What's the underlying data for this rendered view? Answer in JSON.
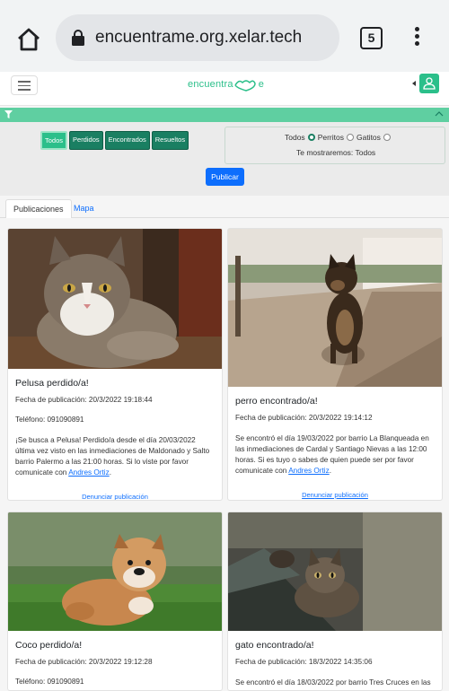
{
  "browser": {
    "url": "encuentrame.org.xelar.tech",
    "tab_count": "5"
  },
  "header": {
    "logo_text_1": "encuentra",
    "logo_text_2": "e",
    "brand_color": "#2bbf8a"
  },
  "filters": {
    "status_buttons": [
      "Todos",
      "Perdidos",
      "Encontrados",
      "Resueltos"
    ],
    "active_status": "Todos",
    "type_label": "Todos",
    "type_options": [
      "Perritos",
      "Gatitos"
    ],
    "selected_type": "Perritos",
    "showing_text": "Te mostraremos: Todos",
    "publish_label": "Publicar"
  },
  "tabs": {
    "publicaciones": "Publicaciones",
    "mapa": "Mapa"
  },
  "posts": [
    {
      "title": "Pelusa perdido/a!",
      "date": "Fecha de publicación: 20/3/2022 19:18:44",
      "phone": "Teléfono: 091090891",
      "desc": "¡Se busca a Pelusa! Perdido/a desde el día 20/03/2022 última vez visto en las inmediaciones de Maldonado y Salto barrio Palermo a las 21:00 horas. Si lo viste por favor comunicate con",
      "contact": "Andres Ortiz",
      "report": "Denunciar publicación",
      "image": "cat-photo"
    },
    {
      "title": "perro encontrado/a!",
      "date": "Fecha de publicación: 20/3/2022 19:14:12",
      "desc": "Se encontró el día 19/03/2022 por barrio La Blanqueada en las inmediaciones de Cardal y Santiago Nievas a las 12:00 horas. Si es tuyo o sabes de quien puede ser por favor comunicate con",
      "contact": "Andres Ortiz",
      "report": "Denunciar publicación",
      "image": "dog-photo"
    },
    {
      "title": "Coco perdido/a!",
      "date": "Fecha de publicación: 20/3/2022 19:12:28",
      "phone": "Teléfono: 091090891",
      "image": "bulldog-photo"
    },
    {
      "title": "gato encontrado/a!",
      "date": "Fecha de publicación: 18/3/2022 14:35:06",
      "desc_partial": "Se encontró el día 18/03/2022 por barrio Tres Cruces en las",
      "image": "kitten-photo"
    }
  ]
}
